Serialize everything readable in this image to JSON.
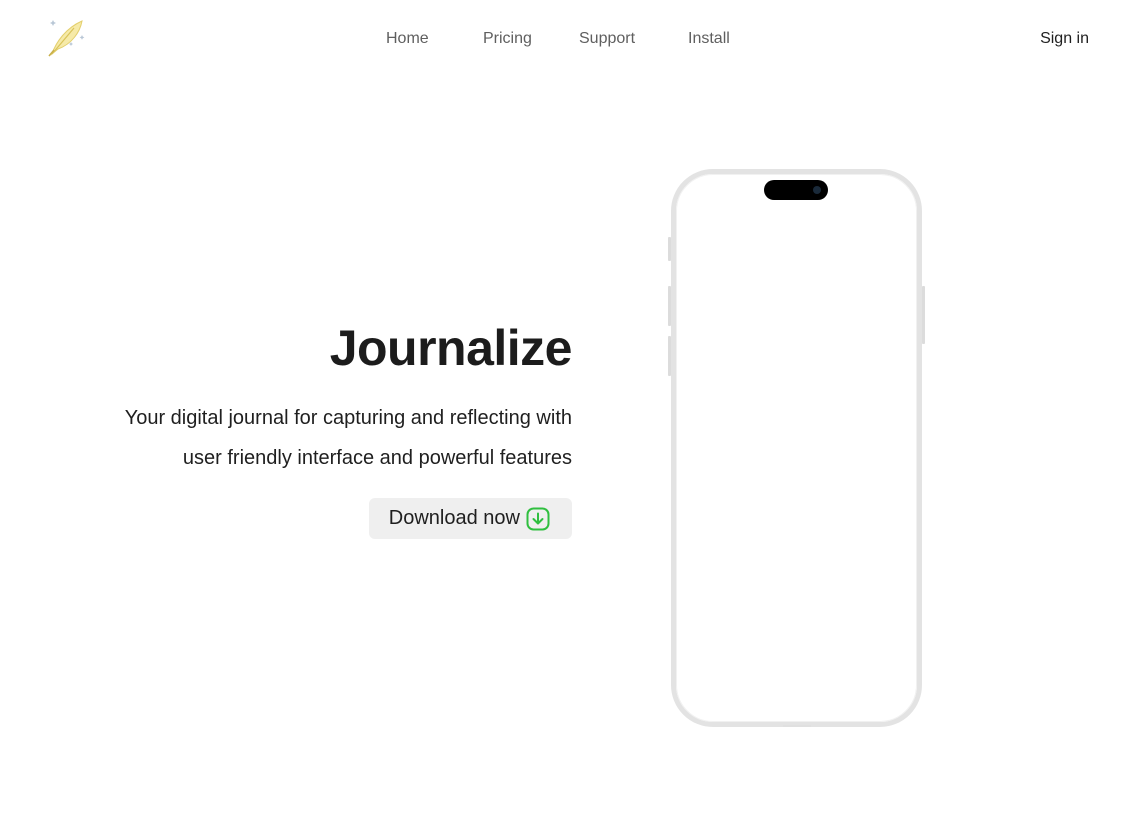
{
  "header": {
    "logo_icon": "feather-quill-icon",
    "nav": [
      {
        "label": "Home"
      },
      {
        "label": "Pricing"
      },
      {
        "label": "Support"
      },
      {
        "label": "Install"
      }
    ],
    "signin_label": "Sign in"
  },
  "hero": {
    "title": "Journalize",
    "description": "Your digital journal for capturing and reflecting with user friendly interface and powerful features",
    "download_label": "Download now",
    "download_icon": "download-arrow-icon"
  },
  "phone": {
    "device_icon": "phone-mockup"
  },
  "colors": {
    "accent_green": "#2fbf3f",
    "button_bg": "#efefef",
    "phone_frame": "#e3e3e3",
    "logo_yellow": "#f3e6a0"
  }
}
